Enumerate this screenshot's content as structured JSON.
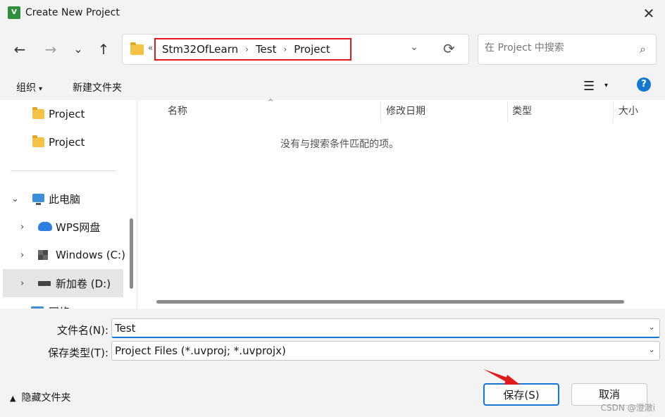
{
  "window": {
    "app_icon_text": "V",
    "title": "Create New Project",
    "close_glyph": "✕"
  },
  "nav": {
    "back_glyph": "←",
    "forward_glyph": "→",
    "recent_glyph": "⌄",
    "up_glyph": "↑",
    "address": {
      "overflow": "«",
      "crumbs": [
        "Stm32OfLearn",
        "Test",
        "Project"
      ],
      "separator": "›",
      "dropdown_glyph": "⌄",
      "refresh_glyph": "⟳"
    },
    "search": {
      "placeholder": "在 Project 中搜索",
      "icon_glyph": "⌕"
    }
  },
  "toolbar": {
    "organize": "组织",
    "new_folder": "新建文件夹",
    "view_glyph": "☰",
    "view_dd": "▾",
    "help": "?"
  },
  "sidebar": {
    "items": [
      {
        "label": "Project"
      },
      {
        "label": "Project"
      },
      {
        "label": "此电脑"
      },
      {
        "label": "WPS网盘"
      },
      {
        "label": "Windows  (C:)"
      },
      {
        "label": "新加卷 (D:)"
      },
      {
        "label": "网络"
      }
    ],
    "chevron_open": "⌄",
    "chevron_closed": "›"
  },
  "file_list": {
    "columns": [
      "名称",
      "修改日期",
      "类型",
      "大小"
    ],
    "sort_indicator": "^",
    "empty_message": "没有与搜索条件匹配的项。"
  },
  "form": {
    "filename_label": "文件名(N):",
    "filename_value": "Test",
    "filetype_label": "保存类型(T):",
    "filetype_value": "Project Files (*.uvproj; *.uvprojx)",
    "dropdown_glyph": "⌄"
  },
  "footer": {
    "hide_folders": "隐藏文件夹",
    "hide_caret": "▲",
    "save": "保存(S)",
    "cancel": "取消",
    "watermark": "CSDN @澄澈i"
  },
  "colors": {
    "highlight_box": "#e01a1a",
    "accent": "#1677d2",
    "folder": "#f5c343"
  }
}
